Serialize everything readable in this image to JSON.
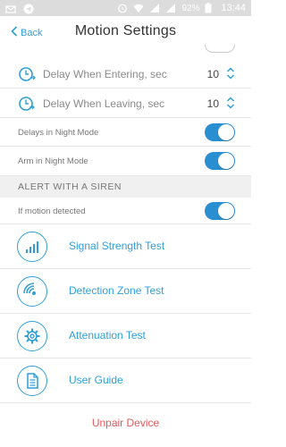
{
  "statusbar": {
    "battery": "92%",
    "time": "13:44"
  },
  "navbar": {
    "back_label": "Back",
    "title": "Motion Settings"
  },
  "settings": {
    "delay_entering": {
      "label": "Delay When Entering, sec",
      "value": "10"
    },
    "delay_leaving": {
      "label": "Delay When Leaving, sec",
      "value": "10"
    },
    "delays_night": {
      "label": "Delays in Night Mode",
      "on": true
    },
    "arm_night": {
      "label": "Arm in Night Mode",
      "on": true
    }
  },
  "siren_section": {
    "header": "ALERT WITH A SIREN",
    "if_motion": {
      "label": "If motion detected",
      "on": true
    }
  },
  "tools": [
    {
      "label": "Signal Strength Test",
      "icon": "signal-bars-icon"
    },
    {
      "label": "Detection Zone Test",
      "icon": "detection-zone-icon"
    },
    {
      "label": "Attenuation Test",
      "icon": "gear-icon"
    },
    {
      "label": "User Guide",
      "icon": "document-icon"
    }
  ],
  "unpair_label": "Unpair Device",
  "colors": {
    "accent": "#2f9fd8",
    "toggle_on": "#2a8fd0",
    "danger": "#e05a5a",
    "statusbar": "#dcdcdc"
  }
}
